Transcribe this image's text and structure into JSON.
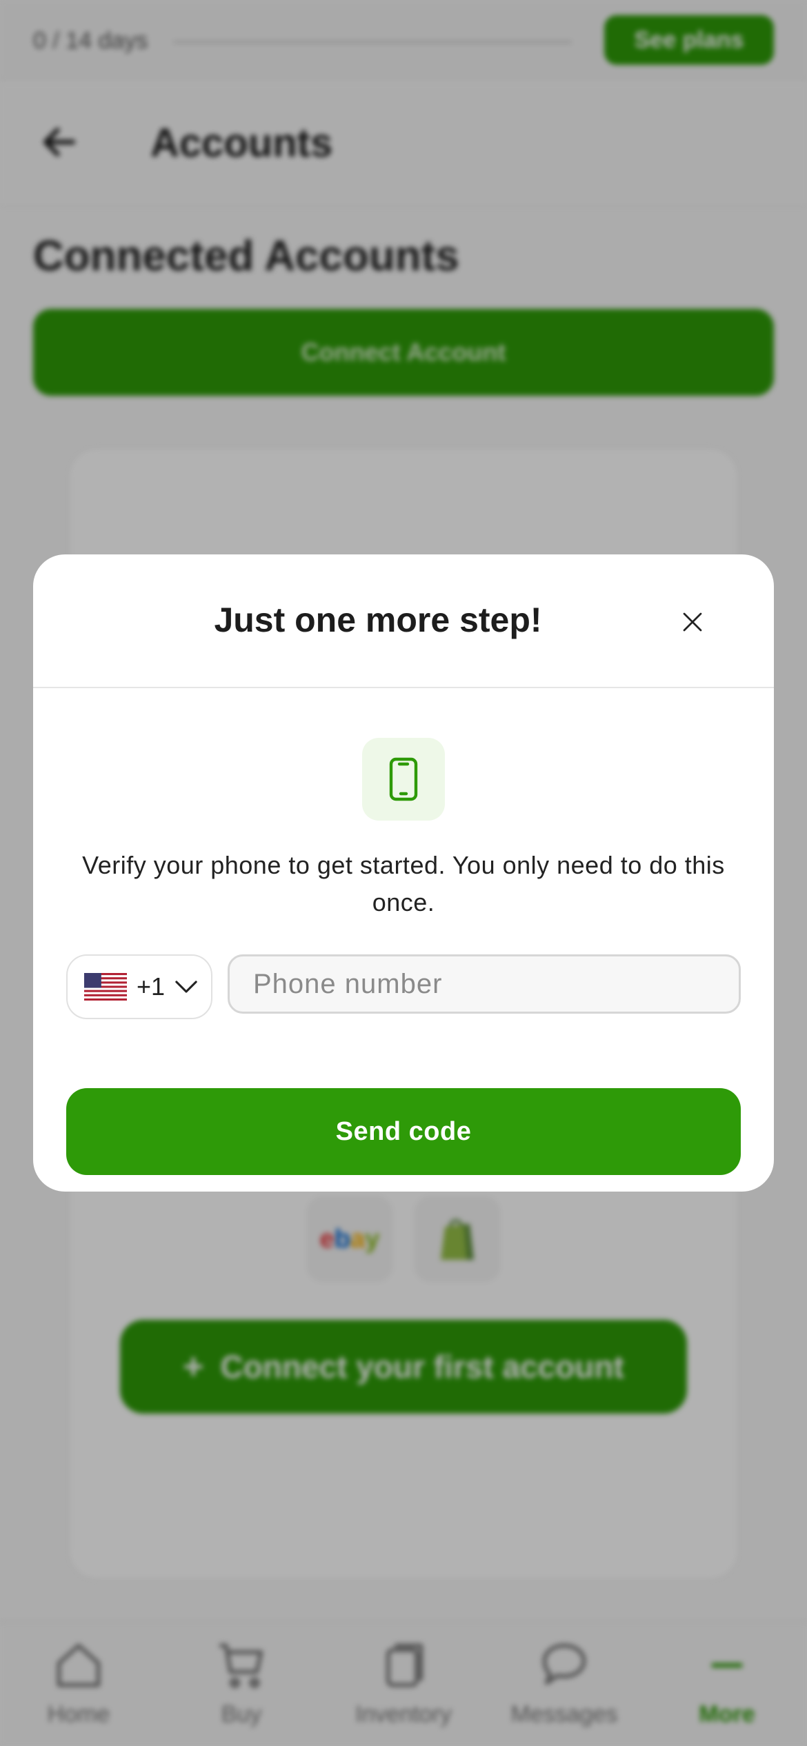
{
  "background": {
    "trial": {
      "text": "0 / 14 days",
      "progress": 0.0
    },
    "see_plans_label": "See plans",
    "header": {
      "title": "Accounts",
      "back_icon": "arrow-left-icon"
    },
    "section_title": "Connected Accounts",
    "connect_account_label": "Connect Account",
    "marketplaces": [
      {
        "name": "eBay",
        "icon": "ebay-logo"
      },
      {
        "name": "Shopify",
        "icon": "shopify-logo"
      }
    ],
    "connect_first_label": "Connect your first account",
    "bottom_nav": [
      {
        "label": "Home",
        "icon": "home-icon",
        "active": false
      },
      {
        "label": "Buy",
        "icon": "cart-icon",
        "active": false
      },
      {
        "label": "Inventory",
        "icon": "inventory-icon",
        "active": false
      },
      {
        "label": "Messages",
        "icon": "chat-icon",
        "active": false
      },
      {
        "label": "More",
        "icon": "more-icon",
        "active": true
      }
    ]
  },
  "modal": {
    "title": "Just one more step!",
    "close_icon": "close-icon",
    "phone_icon": "smartphone-icon",
    "description": "Verify your phone to get started. You only need to do this once.",
    "country": {
      "flag": "us-flag-icon",
      "code": "+1"
    },
    "phone_input": {
      "placeholder": "Phone number",
      "value": ""
    },
    "send_label": "Send code"
  },
  "colors": {
    "accent": "#2e9a08",
    "accent_light": "#eef8e8",
    "overlay": "rgba(0,0,0,0.30)"
  }
}
